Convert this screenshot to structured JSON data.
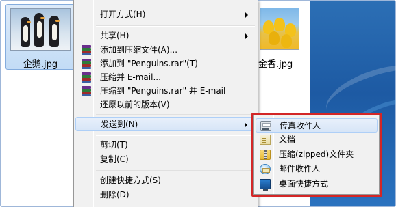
{
  "files": [
    {
      "name": "企鹅.jpg",
      "selected": true
    },
    {
      "name": "金香.jpg",
      "selected": false
    }
  ],
  "context_menu": {
    "items": [
      {
        "label": "打开方式(H)",
        "has_submenu": true,
        "icon": ""
      },
      {
        "label": "共享(H)",
        "has_submenu": true,
        "icon": ""
      },
      {
        "label": "添加到压缩文件(A)...",
        "has_submenu": false,
        "icon": "winrar-icon"
      },
      {
        "label": "添加到 \"Penguins.rar\"(T)",
        "has_submenu": false,
        "icon": "winrar-icon"
      },
      {
        "label": "压缩并 E-mail...",
        "has_submenu": false,
        "icon": "winrar-icon"
      },
      {
        "label": "压缩到 \"Penguins.rar\" 并 E-mail",
        "has_submenu": false,
        "icon": "winrar-icon"
      },
      {
        "label": "还原以前的版本(V)",
        "has_submenu": false,
        "icon": ""
      },
      {
        "label": "发送到(N)",
        "has_submenu": true,
        "icon": "",
        "highlighted": true
      },
      {
        "label": "剪切(T)",
        "has_submenu": false,
        "icon": ""
      },
      {
        "label": "复制(C)",
        "has_submenu": false,
        "icon": ""
      },
      {
        "label": "创建快捷方式(S)",
        "has_submenu": false,
        "icon": ""
      },
      {
        "label": "删除(D)",
        "has_submenu": false,
        "icon": ""
      }
    ]
  },
  "send_to_submenu": {
    "items": [
      {
        "label": "传真收件人",
        "icon": "fax-icon",
        "highlighted": true
      },
      {
        "label": "文档",
        "icon": "documents-icon"
      },
      {
        "label": "压缩(zipped)文件夹",
        "icon": "zip-folder-icon"
      },
      {
        "label": "邮件收件人",
        "icon": "mail-recipient-icon"
      },
      {
        "label": "桌面快捷方式",
        "icon": "desktop-icon"
      }
    ]
  },
  "colors": {
    "menu_background": "#f1f1f1",
    "hover_highlight": "#d7e5f7",
    "annotation_box": "#d32626",
    "selection": "#c3dcf6"
  }
}
